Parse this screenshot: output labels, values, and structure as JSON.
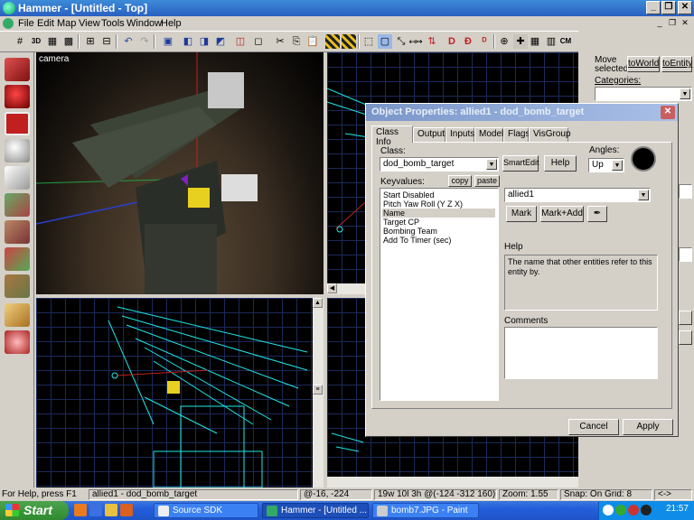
{
  "window": {
    "title": "Hammer - [Untitled - Top]",
    "controls": {
      "minimize": "_",
      "restore": "❐",
      "close": "✕"
    },
    "mdi_controls": {
      "minimize": "_",
      "restore": "❐",
      "close": "✕"
    }
  },
  "menu": [
    "File",
    "Edit",
    "Map",
    "View",
    "Tools",
    "Window",
    "Help"
  ],
  "toolbar": {
    "labels": {
      "three_d": "3D",
      "cm": "CM"
    }
  },
  "viewports": {
    "camera_label": "camera"
  },
  "right_panel": {
    "move_selected": "Move selected:",
    "to_world": "toWorld",
    "to_entity": "toEntity",
    "categories": "Categories:"
  },
  "dialog": {
    "title": "Object Properties: allied1 - dod_bomb_target",
    "close": "✕",
    "tabs": [
      "Class Info",
      "Outputs",
      "Inputs",
      "Model",
      "Flags",
      "VisGroup"
    ],
    "active_tab": "Class Info",
    "class_label": "Class:",
    "class_value": "dod_bomb_target",
    "smartedit": "SmartEdit",
    "help_button": "Help",
    "angles_label": "Angles:",
    "angles_value": "Up",
    "keyvalues_label": "Keyvalues:",
    "copy": "copy",
    "paste": "paste",
    "keyvalues": [
      "Start Disabled",
      "Pitch Yaw Roll (Y Z X)",
      "Name",
      "Target CP",
      "Bombing Team",
      "Add To Timer (sec)"
    ],
    "selected_key": "Name",
    "value": "allied1",
    "mark": "Mark",
    "mark_add": "Mark+Add",
    "help_label": "Help",
    "help_text": "The name that other entities refer to this entity by.",
    "comments_label": "Comments",
    "comments_text": "",
    "cancel": "Cancel",
    "apply": "Apply"
  },
  "status": {
    "help": "For Help, press F1",
    "selection": "allied1 - dod_bomb_target",
    "coords": "@-16, -224",
    "size": "19w 10l 3h @(-124 -312 160)",
    "zoom": "Zoom: 1.55",
    "snap": "Snap: On Grid: 8",
    "extra": "<->"
  },
  "taskbar": {
    "start": "Start",
    "tasks": [
      "Source SDK",
      "Hammer - [Untitled ...",
      "bomb7.JPG - Paint"
    ],
    "active_task": "Hammer - [Untitled ...",
    "clock": "21:57"
  }
}
